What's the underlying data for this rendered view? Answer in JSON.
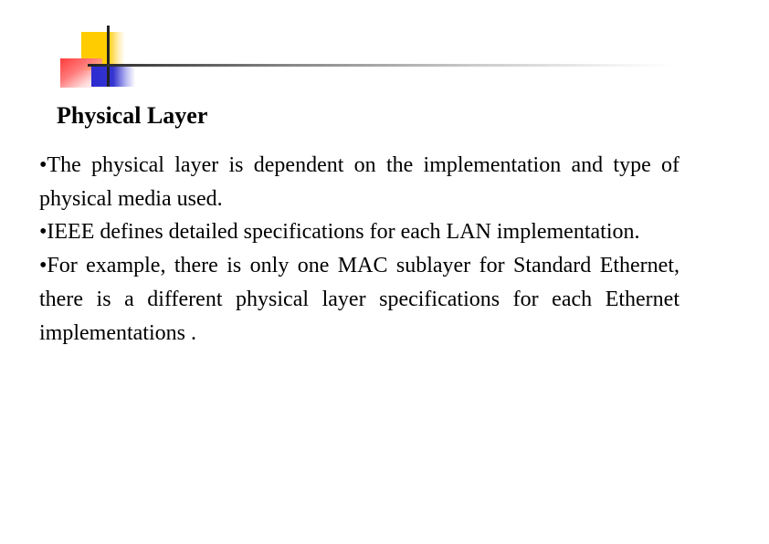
{
  "slide": {
    "title": "Physical Layer",
    "bullets": [
      "•The physical layer is dependent on the implementation and type of physical media used.",
      "•IEEE defines detailed specifications for each LAN implementation.",
      "•For example, there is only one MAC sublayer for Standard Ethernet, there is a different physical layer specifications for each Ethernet implementations ."
    ]
  },
  "logo": {
    "colors": {
      "yellow": "#ffcc00",
      "red": "#ff3b3b",
      "blue": "#2b2bd0",
      "line": "#222222"
    }
  }
}
